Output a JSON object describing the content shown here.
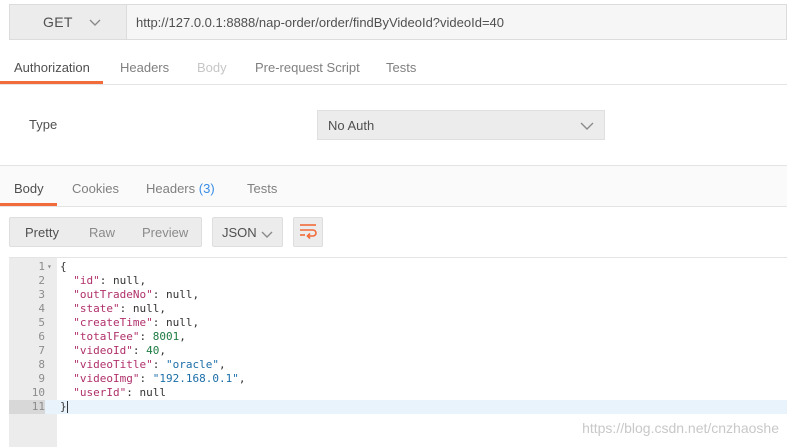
{
  "request": {
    "method": "GET",
    "url": "http://127.0.0.1:8888/nap-order/order/findByVideoId?videoId=40"
  },
  "request_tabs": [
    {
      "label": "Authorization",
      "state": "active"
    },
    {
      "label": "Headers",
      "state": "normal"
    },
    {
      "label": "Body",
      "state": "disabled"
    },
    {
      "label": "Pre-request Script",
      "state": "normal"
    },
    {
      "label": "Tests",
      "state": "normal"
    }
  ],
  "auth": {
    "type_label": "Type",
    "type_value": "No Auth"
  },
  "response_tabs": {
    "body": "Body",
    "cookies": "Cookies",
    "headers": "Headers",
    "headers_count": "(3)",
    "tests": "Tests"
  },
  "toolbar": {
    "pretty": "Pretty",
    "raw": "Raw",
    "preview": "Preview",
    "format": "JSON"
  },
  "response_body": [
    {
      "n": "1",
      "text": "{"
    },
    {
      "n": "2",
      "text": "  \"id\": null,"
    },
    {
      "n": "3",
      "text": "  \"outTradeNo\": null,"
    },
    {
      "n": "4",
      "text": "  \"state\": null,"
    },
    {
      "n": "5",
      "text": "  \"createTime\": null,"
    },
    {
      "n": "6",
      "text": "  \"totalFee\": 8001,"
    },
    {
      "n": "7",
      "text": "  \"videoId\": 40,"
    },
    {
      "n": "8",
      "text": "  \"videoTitle\": \"oracle\","
    },
    {
      "n": "9",
      "text": "  \"videoImg\": \"192.168.0.1\","
    },
    {
      "n": "10",
      "text": "  \"userId\": null"
    },
    {
      "n": "11",
      "text": "}"
    }
  ],
  "active_line": "11",
  "watermark": "https://blog.csdn.net/cnzhaoshe",
  "colors": {
    "accent": "#f26b3a",
    "badge": "#3a8ee6",
    "json_key": "#b0306b",
    "json_string": "#1b6ea8",
    "json_number": "#1e7b43"
  }
}
